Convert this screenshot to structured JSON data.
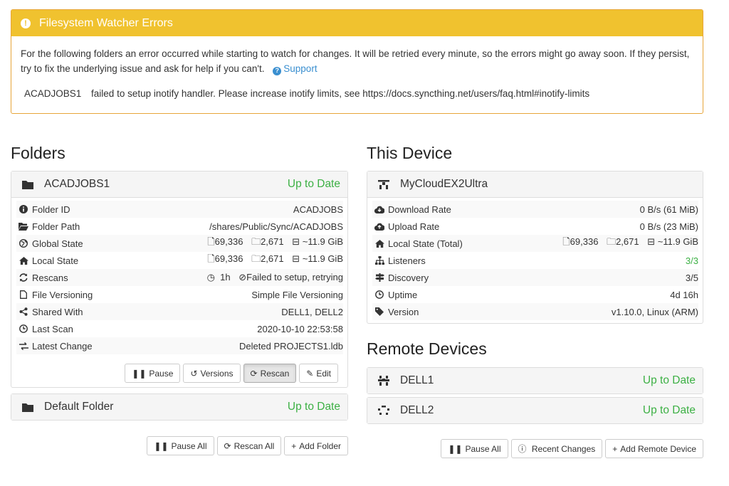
{
  "alert": {
    "title": "Filesystem Watcher Errors",
    "message": "For the following folders an error occurred while starting to watch for changes. It will be retried every minute, so the errors might go away soon. If they persist, try to fix the underlying issue and ask for help if you can't.",
    "support_label": "Support",
    "error_folder": "ACADJOBS1",
    "error_text": "failed to setup inotify handler. Please increase inotify limits, see https://docs.syncthing.net/users/faq.html#inotify-limits"
  },
  "folders": {
    "heading": "Folders",
    "items": [
      {
        "name": "ACADJOBS1",
        "status": "Up to Date",
        "rows": {
          "folder_id": {
            "label": "Folder ID",
            "value": "ACADJOBS"
          },
          "folder_path": {
            "label": "Folder Path",
            "value": "/shares/Public/Sync/ACADJOBS"
          },
          "global_state": {
            "label": "Global State",
            "files": "69,336",
            "dirs": "2,671",
            "size": "~11.9 GiB"
          },
          "local_state": {
            "label": "Local State",
            "files": "69,336",
            "dirs": "2,671",
            "size": "~11.9 GiB"
          },
          "rescans": {
            "label": "Rescans",
            "interval": "1h",
            "watch": "Failed to setup, retrying"
          },
          "file_versioning": {
            "label": "File Versioning",
            "value": "Simple File Versioning"
          },
          "shared_with": {
            "label": "Shared With",
            "value": "DELL1, DELL2"
          },
          "last_scan": {
            "label": "Last Scan",
            "value": "2020-10-10 22:53:58"
          },
          "latest_change": {
            "label": "Latest Change",
            "value": "Deleted PROJECTS1.ldb"
          }
        },
        "buttons": {
          "pause": "Pause",
          "versions": "Versions",
          "rescan": "Rescan",
          "edit": "Edit"
        }
      },
      {
        "name": "Default Folder",
        "status": "Up to Date"
      }
    ],
    "buttons": {
      "pause_all": "Pause All",
      "rescan_all": "Rescan All",
      "add_folder": "Add Folder"
    }
  },
  "this_device": {
    "heading": "This Device",
    "name": "MyCloudEX2Ultra",
    "rows": {
      "download_rate": {
        "label": "Download Rate",
        "value": "0 B/s (61 MiB)"
      },
      "upload_rate": {
        "label": "Upload Rate",
        "value": "0 B/s (23 MiB)"
      },
      "local_state": {
        "label": "Local State (Total)",
        "files": "69,336",
        "dirs": "2,671",
        "size": "~11.9 GiB"
      },
      "listeners": {
        "label": "Listeners",
        "value": "3/3"
      },
      "discovery": {
        "label": "Discovery",
        "value": "3/5"
      },
      "uptime": {
        "label": "Uptime",
        "value": "4d 16h"
      },
      "version": {
        "label": "Version",
        "value": "v1.10.0, Linux (ARM)"
      }
    }
  },
  "remote_devices": {
    "heading": "Remote Devices",
    "items": [
      {
        "name": "DELL1",
        "status": "Up to Date"
      },
      {
        "name": "DELL2",
        "status": "Up to Date"
      }
    ],
    "buttons": {
      "pause_all": "Pause All",
      "recent_changes": "Recent Changes",
      "add_remote": "Add Remote Device"
    }
  },
  "colors": {
    "warning": "#f0c22f",
    "success": "#3cb044",
    "link": "#3a8fd0"
  }
}
